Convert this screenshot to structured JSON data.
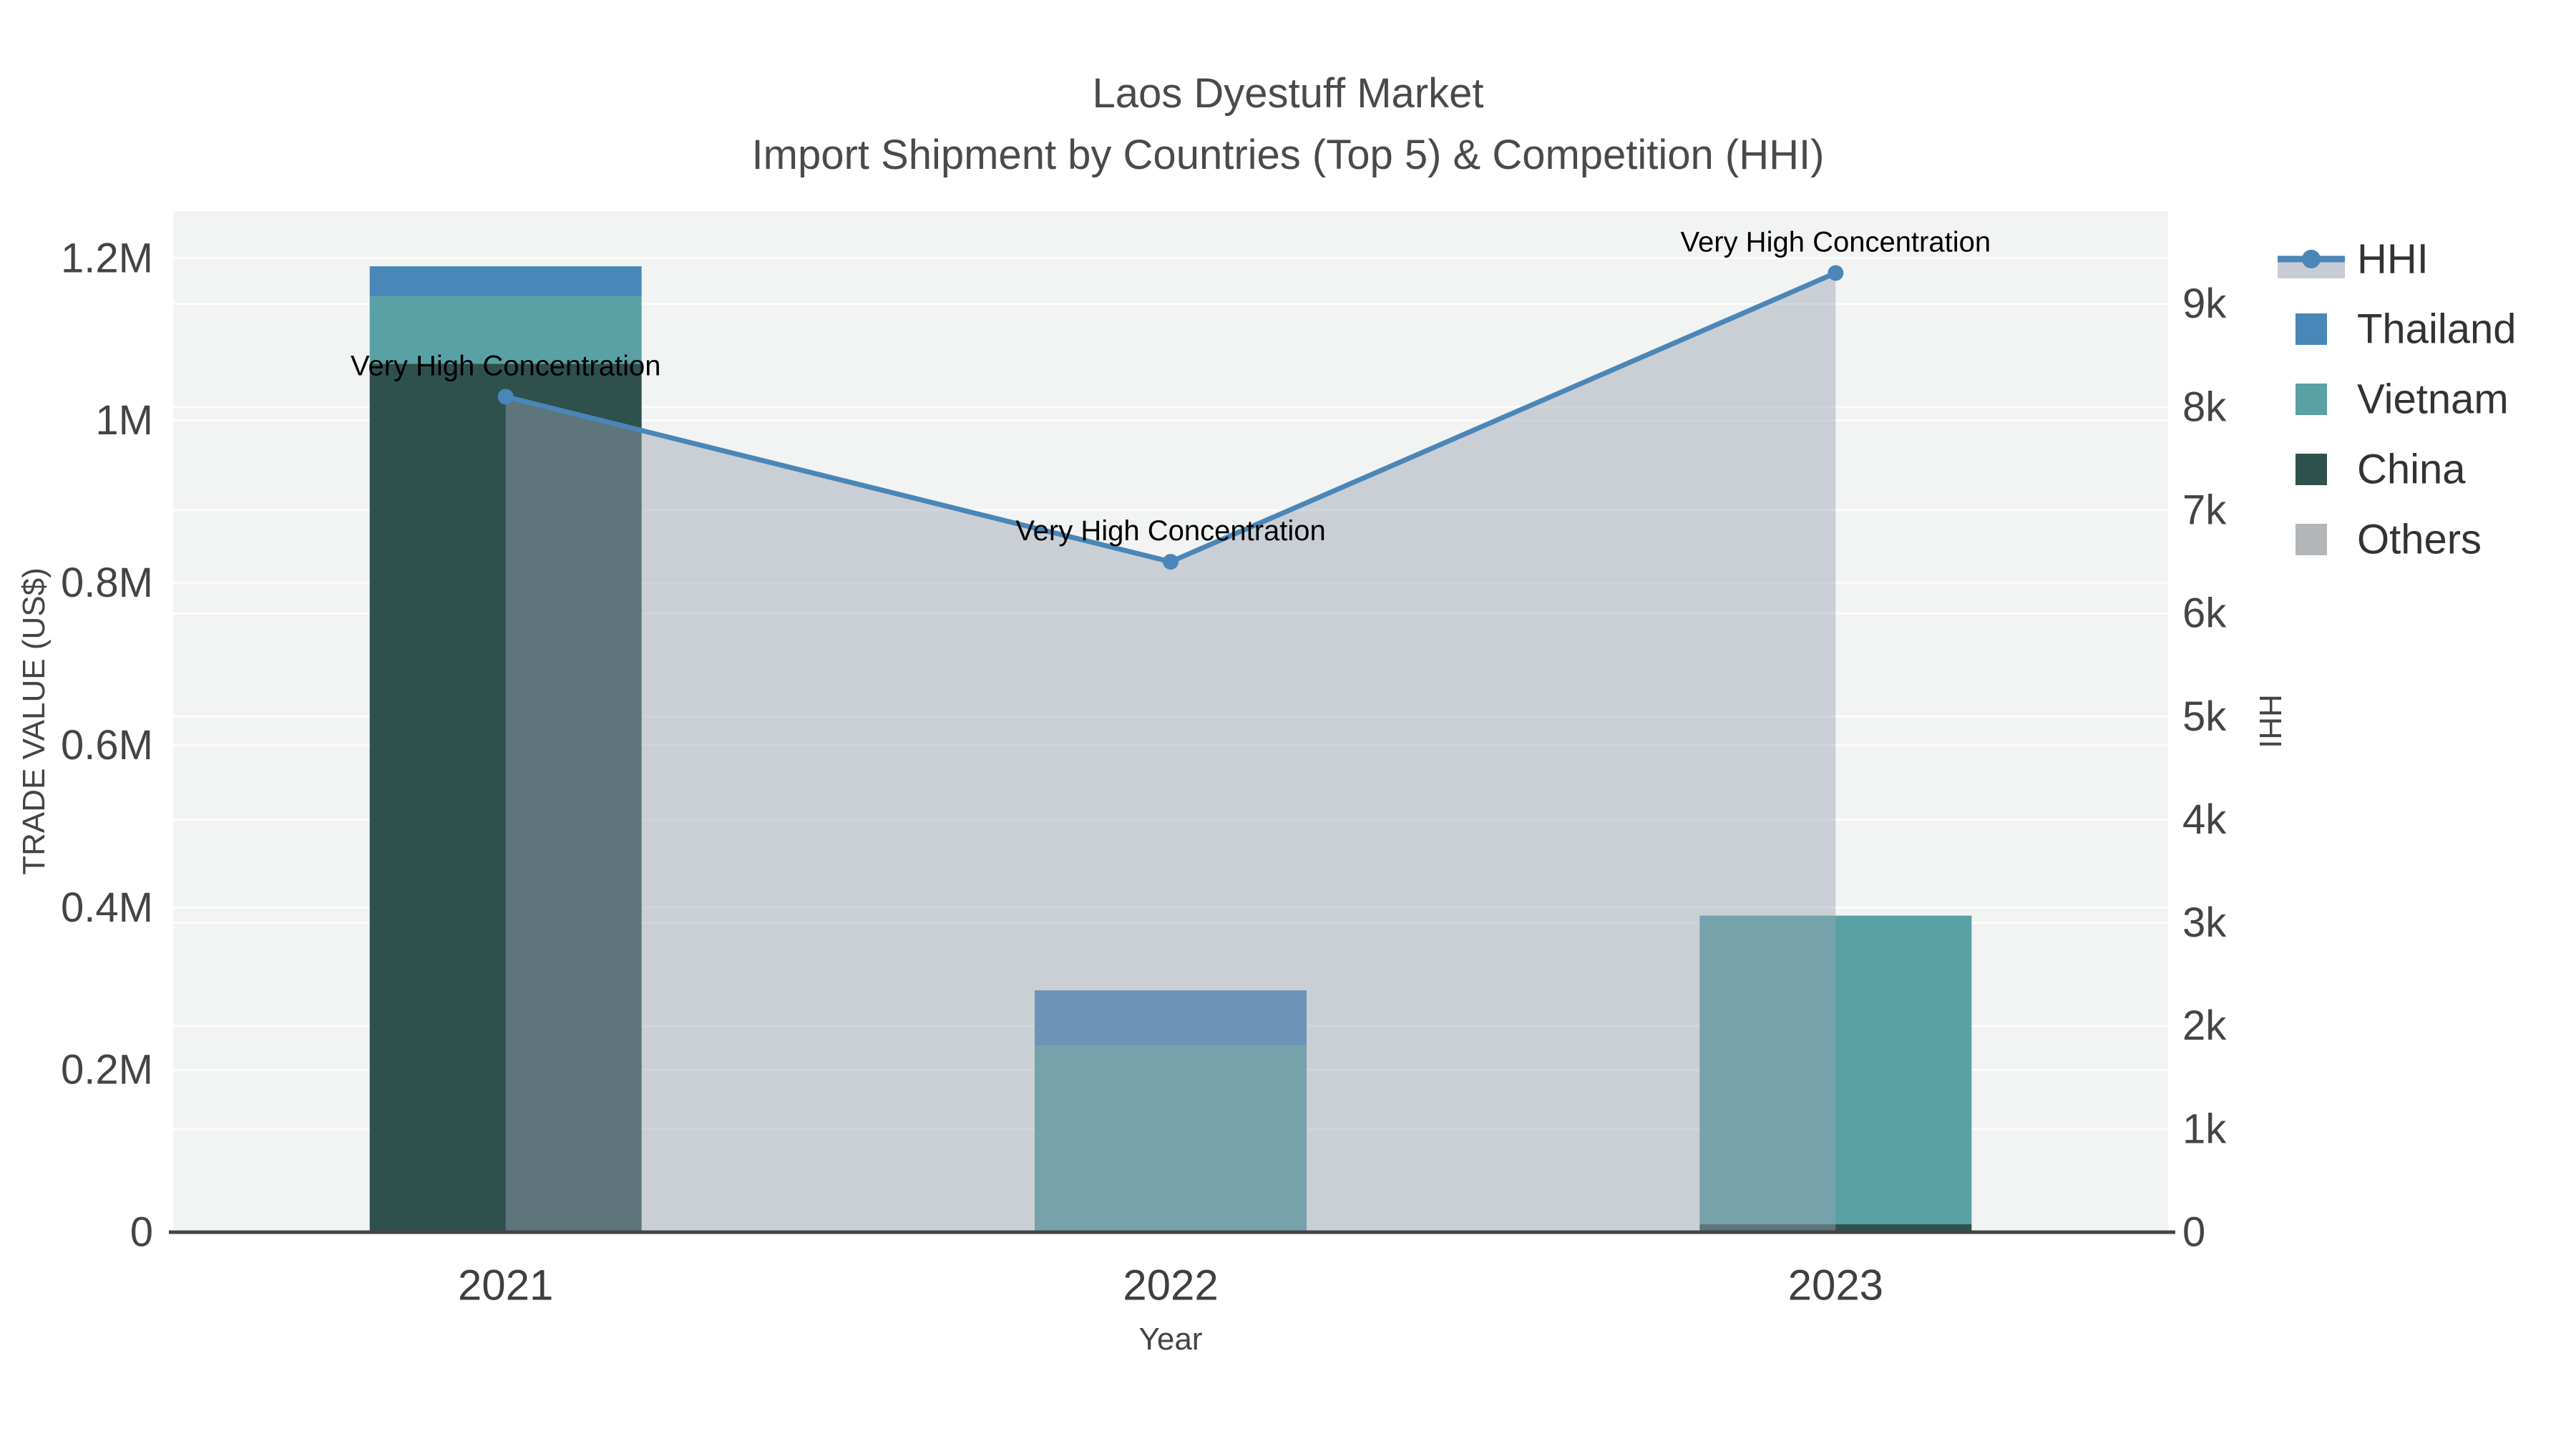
{
  "title": {
    "line1": "Laos Dyestuff Market",
    "line2": "Import Shipment by Countries (Top 5) & Competition (HHI)"
  },
  "axes": {
    "x": {
      "title": "Year",
      "ticks": [
        "2021",
        "2022",
        "2023"
      ]
    },
    "y_left": {
      "title": "TRADE VALUE (US$)",
      "ticks": [
        {
          "v": 0,
          "label": "0"
        },
        {
          "v": 200000,
          "label": "0.2M"
        },
        {
          "v": 400000,
          "label": "0.4M"
        },
        {
          "v": 600000,
          "label": "0.6M"
        },
        {
          "v": 800000,
          "label": "0.8M"
        },
        {
          "v": 1000000,
          "label": "1M"
        },
        {
          "v": 1200000,
          "label": "1.2M"
        }
      ]
    },
    "y_right": {
      "title": "HHI",
      "ticks": [
        {
          "v": 0,
          "label": "0"
        },
        {
          "v": 1000,
          "label": "1k"
        },
        {
          "v": 2000,
          "label": "2k"
        },
        {
          "v": 3000,
          "label": "3k"
        },
        {
          "v": 4000,
          "label": "4k"
        },
        {
          "v": 5000,
          "label": "5k"
        },
        {
          "v": 6000,
          "label": "6k"
        },
        {
          "v": 7000,
          "label": "7k"
        },
        {
          "v": 8000,
          "label": "8k"
        },
        {
          "v": 9000,
          "label": "9k"
        }
      ]
    }
  },
  "legend": {
    "items": [
      {
        "name": "HHI",
        "type": "line-area",
        "line_color": "#4a86b8",
        "area_color": "#c7ccd5"
      },
      {
        "name": "Thailand",
        "type": "square",
        "color": "#4a87b9"
      },
      {
        "name": "Vietnam",
        "type": "square",
        "color": "#59a1a4"
      },
      {
        "name": "China",
        "type": "square",
        "color": "#2e514e"
      },
      {
        "name": "Others",
        "type": "square",
        "color": "#b3b6b8"
      }
    ]
  },
  "colors": {
    "plot_background": "#f2f3f3",
    "gridline": "#ffffff",
    "axis_line": "#444444",
    "hhi_line": "#4a86b8",
    "hhi_fill": "rgba(154,163,180,0.45)"
  },
  "chart_data": {
    "type": "combo-stacked-bar-line",
    "categories": [
      "2021",
      "2022",
      "2023"
    ],
    "bar_series": [
      {
        "name": "China",
        "color": "#2e514e",
        "values": [
          1070000,
          0,
          10000
        ]
      },
      {
        "name": "Vietnam",
        "color": "#59a1a4",
        "values": [
          83000,
          230000,
          380000
        ]
      },
      {
        "name": "Thailand",
        "color": "#4a87b9",
        "values": [
          37000,
          68000,
          0
        ]
      },
      {
        "name": "Others",
        "color": "#b3b6b8",
        "values": [
          0,
          0,
          0
        ]
      }
    ],
    "line_series": {
      "name": "HHI",
      "axis": "right",
      "color": "#4a86b8",
      "fill_color": "rgba(154,163,180,0.45)",
      "values": [
        8100,
        6500,
        9300
      ]
    },
    "annotations": [
      "Very High Concentration",
      "Very High Concentration",
      "Very High Concentration"
    ],
    "title": "Laos Dyestuff Market — Import Shipment by Countries (Top 5) & Competition (HHI)",
    "xlabel": "Year",
    "ylabel_left": "TRADE VALUE (US$)",
    "ylabel_right": "HHI",
    "ylim_left": [
      0,
      1258000
    ],
    "ylim_right": [
      0,
      9900
    ],
    "grid": true,
    "legend_position": "right"
  }
}
